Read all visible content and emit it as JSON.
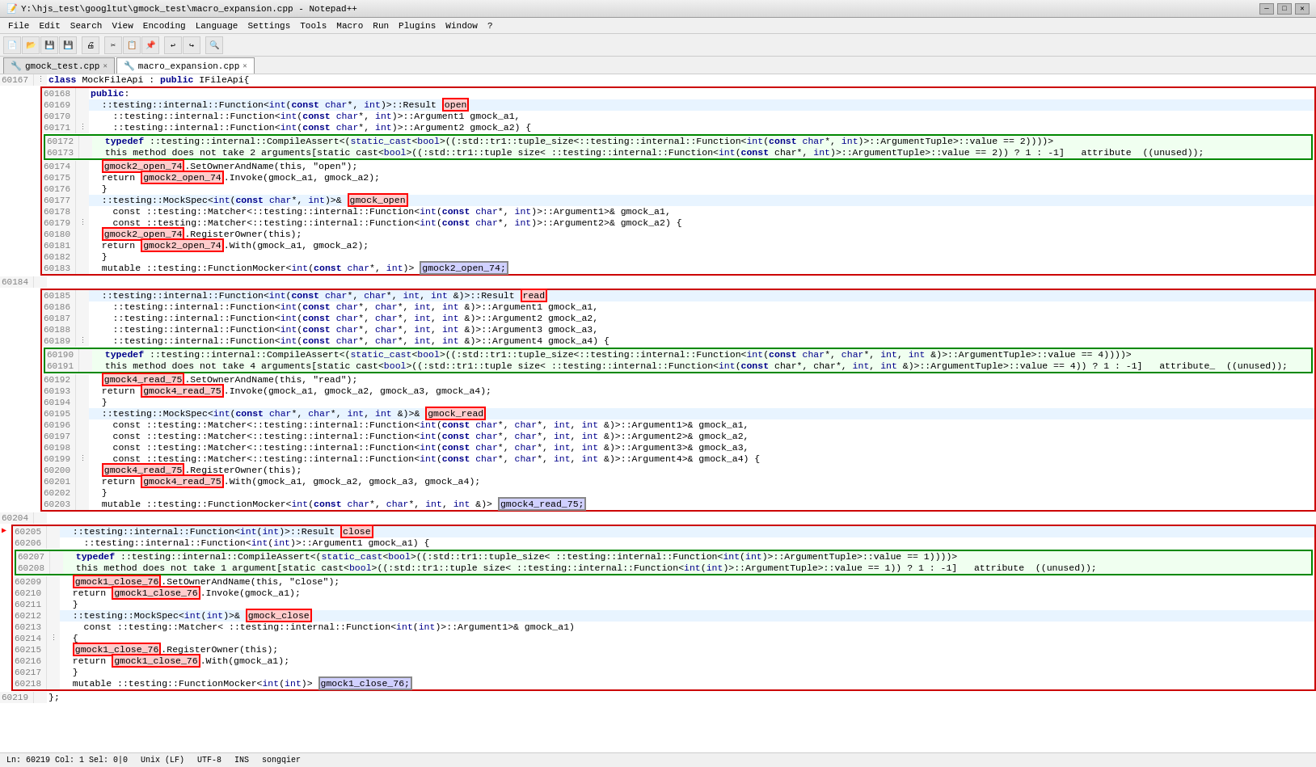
{
  "titlebar": {
    "title": "Y:\\hjs_test\\googltut\\gmock_test\\macro_expansion.cpp - Notepad++",
    "minimize": "—",
    "maximize": "□",
    "close": "✕"
  },
  "menubar": {
    "items": [
      "File",
      "Edit",
      "Search",
      "View",
      "Encoding",
      "Language",
      "Settings",
      "Tools",
      "Macro",
      "Run",
      "Plugins",
      "Window",
      "?"
    ]
  },
  "tabs": [
    {
      "label": "gmock_test.cpp",
      "active": false
    },
    {
      "label": "macro_expansion.cpp",
      "active": true
    }
  ],
  "statusbar": {
    "text": "songqier"
  }
}
